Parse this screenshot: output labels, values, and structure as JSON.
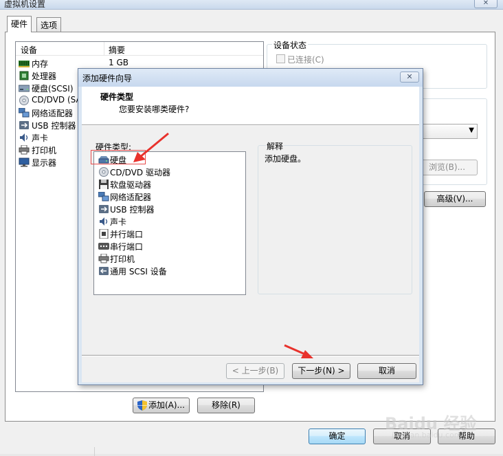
{
  "window": {
    "title": "虚拟机设置",
    "close_glyph": "✕"
  },
  "tabs": [
    {
      "label": "硬件",
      "active": true
    },
    {
      "label": "选项",
      "active": false
    }
  ],
  "device_table": {
    "headers": {
      "device": "设备",
      "summary": "摘要"
    },
    "rows": [
      {
        "icon": "memory-icon",
        "label": "内存",
        "summary": "1 GB"
      },
      {
        "icon": "processor-icon",
        "label": "处理器",
        "summary": ""
      },
      {
        "icon": "hard-disk-icon",
        "label": "硬盘(SCSI)",
        "summary": ""
      },
      {
        "icon": "cd-dvd-icon",
        "label": "CD/DVD (SA",
        "summary": ""
      },
      {
        "icon": "network-adapter-icon",
        "label": "网络适配器",
        "summary": ""
      },
      {
        "icon": "usb-controller-icon",
        "label": "USB 控制器",
        "summary": ""
      },
      {
        "icon": "sound-card-icon",
        "label": "声卡",
        "summary": ""
      },
      {
        "icon": "printer-icon",
        "label": "打印机",
        "summary": ""
      },
      {
        "icon": "display-icon",
        "label": "显示器",
        "summary": ""
      }
    ]
  },
  "device_status": {
    "title": "设备状态",
    "connected_label": "已连接(C)",
    "connected_checked": false
  },
  "connection": {
    "browse_label": "浏览(B)...",
    "advanced_label": "高级(V)..."
  },
  "device_buttons": {
    "add_label": "添加(A)...",
    "remove_label": "移除(R)"
  },
  "dialog_buttons": {
    "ok_label": "确定",
    "cancel_label": "取消",
    "help_label": "帮助"
  },
  "wizard": {
    "title": "添加硬件向导",
    "close_glyph": "✕",
    "heading": "硬件类型",
    "subheading": "您要安装哪类硬件?",
    "list_label": "硬件类型:",
    "hardware_types": [
      {
        "icon": "hard-disk-icon",
        "label": "硬盘",
        "selected": true
      },
      {
        "icon": "cd-dvd-icon",
        "label": "CD/DVD 驱动器",
        "selected": false
      },
      {
        "icon": "floppy-icon",
        "label": "软盘驱动器",
        "selected": false
      },
      {
        "icon": "network-adapter-icon",
        "label": "网络适配器",
        "selected": false
      },
      {
        "icon": "usb-controller-icon",
        "label": "USB 控制器",
        "selected": false
      },
      {
        "icon": "sound-card-icon",
        "label": "声卡",
        "selected": false
      },
      {
        "icon": "parallel-port-icon",
        "label": "并行端口",
        "selected": false
      },
      {
        "icon": "serial-port-icon",
        "label": "串行端口",
        "selected": false
      },
      {
        "icon": "printer-icon",
        "label": "打印机",
        "selected": false
      },
      {
        "icon": "generic-scsi-icon",
        "label": "通用 SCSI 设备",
        "selected": false
      }
    ],
    "explanation_title": "解释",
    "explanation_text": "添加硬盘。",
    "back_label": "< 上一步(B)",
    "next_label": "下一步(N) >",
    "cancel_label": "取消"
  },
  "watermark": {
    "text": "Baidu 经验",
    "sub": "jingyan.baidu.com"
  },
  "colors": {
    "annotation_red": "#e8322c",
    "primary_button_border": "#3c7fb1"
  }
}
